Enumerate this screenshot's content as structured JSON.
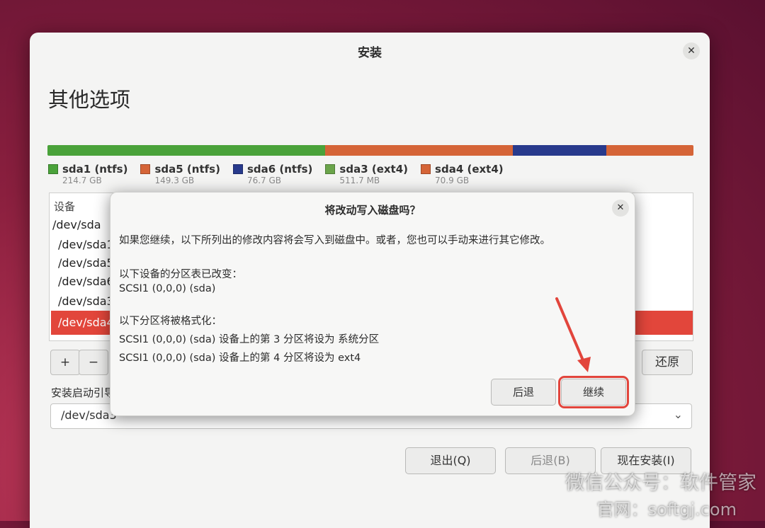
{
  "window": {
    "title": "安装",
    "close_icon": "close-icon"
  },
  "page_title": "其他选项",
  "partition_bar": [
    {
      "name": "sda1 (ntfs)",
      "size": "214.7 GB",
      "color": "#4aa23a",
      "fraction": 0.43
    },
    {
      "name": "sda5 (ntfs)",
      "size": "149.3 GB",
      "color": "#d56437",
      "fraction": 0.29
    },
    {
      "name": "sda6 (ntfs)",
      "size": "76.7 GB",
      "color": "#283a8c",
      "fraction": 0.145
    },
    {
      "name": "sda3 (ext4)",
      "size": "511.7 MB",
      "color": "#6aa44a",
      "fraction": 0.0
    },
    {
      "name": "sda4 (ext4)",
      "size": "70.9 GB",
      "color": "#d56437",
      "fraction": 0.135
    }
  ],
  "tree": {
    "header": "设备",
    "rows": [
      {
        "label": "/dev/sda",
        "indent": false,
        "selected": false
      },
      {
        "label": "/dev/sda1",
        "indent": true,
        "selected": false
      },
      {
        "label": "/dev/sda5",
        "indent": true,
        "selected": false
      },
      {
        "label": "/dev/sda6",
        "indent": true,
        "selected": false
      },
      {
        "label": "/dev/sda3",
        "indent": true,
        "selected": false
      },
      {
        "label": "/dev/sda4",
        "indent": true,
        "selected": true
      }
    ]
  },
  "controls": {
    "add": "+",
    "remove": "−",
    "revert": "还原"
  },
  "boot": {
    "label": "安装启动引导器的设备：",
    "value": "/dev/sda3"
  },
  "footer": {
    "quit": "退出(Q)",
    "back": "后退(B)",
    "install": "现在安装(I)"
  },
  "dialog": {
    "title": "将改动写入磁盘吗？",
    "intro": "如果您继续，以下所列出的修改内容将会写入到磁盘中。或者，您也可以手动来进行其它修改。",
    "table_changed_label": "以下设备的分区表已改变：",
    "table_changed_device": "SCSI1 (0,0,0) (sda)",
    "format_label": "以下分区将被格式化：",
    "format_items": [
      "SCSI1 (0,0,0) (sda) 设备上的第 3 分区将设为 系统分区",
      "SCSI1 (0,0,0) (sda) 设备上的第 4 分区将设为 ext4"
    ],
    "back": "后退",
    "continue": "继续"
  },
  "watermark": {
    "line1": "微信公众号：软件管家",
    "line2": "官网：softgj.com"
  }
}
